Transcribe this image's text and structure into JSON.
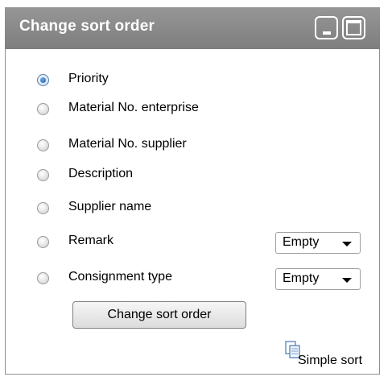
{
  "panel": {
    "title": "Change sort order",
    "minimize_icon": "minimize-icon",
    "maximize_icon": "maximize-icon"
  },
  "options": [
    {
      "label": "Priority",
      "checked": true
    },
    {
      "label": "Material No. enterprise",
      "checked": false
    },
    {
      "label": "Material No. supplier",
      "checked": false
    },
    {
      "label": "Description",
      "checked": false
    },
    {
      "label": "Supplier name",
      "checked": false
    },
    {
      "label": "Remark",
      "checked": false,
      "select_value": "Empty"
    },
    {
      "label": "Consignment type",
      "checked": false,
      "select_value": "Empty"
    }
  ],
  "action_button": "Change sort order",
  "simple_sort": {
    "label": "Simple sort",
    "icon": "copy-document-icon"
  },
  "colors": {
    "header": "#8a8a8a",
    "accent": "#1f5fb3"
  }
}
